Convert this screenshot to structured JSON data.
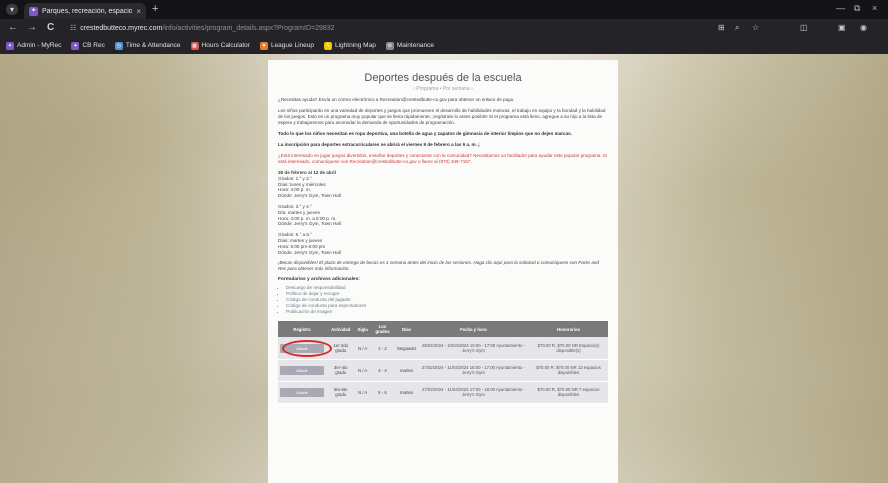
{
  "browser": {
    "tab": {
      "title": "Parques, recreación, espacios a",
      "close": "×"
    },
    "new_tab": "+",
    "window_controls": [
      "—",
      "⧉",
      "×"
    ],
    "nav": {
      "back": "←",
      "forward": "→",
      "reload": "C"
    },
    "url": {
      "host": "crestedbutteco.myrec.com",
      "path": "/info/activities/program_details.aspx?ProgramID=29832"
    },
    "bookmarks": [
      {
        "label": "Admin - MyRec",
        "color": "#7b5cc6"
      },
      {
        "label": "CB Rec",
        "color": "#7b5cc6"
      },
      {
        "label": "Time & Attendance",
        "color": "#5a8fd6"
      },
      {
        "label": "Hours Calculator",
        "color": "#d9534f"
      },
      {
        "label": "League Lineup",
        "color": "#e67e22"
      },
      {
        "label": "Lightning Map",
        "color": "#f1c40f"
      },
      {
        "label": "Maintenance",
        "color": "#888888"
      }
    ]
  },
  "program": {
    "title": "Deportes después de la escuela",
    "breadcrumb": "‹ Programa • Por semana ›",
    "p1": "¿Necesitas ayuda? Envía un correo electrónico a Recreation@crestedbutte-co.gov para obtener un enlace de pago.",
    "p2": "Los niños participarán en una variedad de deportes y juegos que promueven el desarrollo de habilidades motoras, el trabajo en equipo y la bondad y la habilidad de los juegos. Esto es un programa muy popular que se llena rápidamente, ¡regístrate lo antes posible! Si el programa está lleno, agregue a su hijo a la lista de espera y trabajaremos para acomodar la demanda de oportunidades de programación.",
    "p3": "Todo lo que los niños necesitan es ropa deportiva, una botella de agua y zapatos de gimnasia de interior limpios que no dejen marcas.",
    "p4": "La inscripción para deportes extracurriculares se abrirá el viernes 9 de febrero a las 9 a. m. ¡",
    "p5": "¿Está interesado en jugar juegos divertidos, enseñar deportes y conectarse con la comunidad? Necesitamos un facilitador para ayudar este popular programa. Si está interesado, comuníquese con Recreation@crestedbutte-co.gov o llame al (970) 349-7167.",
    "s1": [
      "28 de febrero al 12 de abril",
      "Grados: 1.° y 2.°",
      "Días: lunes y miércoles",
      "Hora: 4:00 p. m.",
      "Dónde: Jerry's Gym, Town Hall"
    ],
    "s2": [
      "Grados: 3.° y 4.°",
      "Día: martes y jueves",
      "Hora: 4:00 p. m. a 5:00 p. m.",
      "Dónde: Jerry's Gym, Town Hall"
    ],
    "s3": [
      "Grados: 5.° a 6.°",
      "Días: martes y jueves",
      "Hora: 5:00 pm-6:00 pm",
      "Dónde: Jerry's Gym, Town Hall"
    ],
    "note": "¡Becas disponibles! El plazo de entrega de becas es 1 semana antes del inicio de las sesiones. Haga clic aquí para la solicitud o comuníquese con Parks and Rec para obtener más información.",
    "files_heading": "Formularios y archivos adicionales:",
    "files": [
      "Descargo de responsabilidad",
      "Política de dejar y recoger",
      "Código de conducta del jugador",
      "Código de conducta para espectadores",
      "Publicación de imagen"
    ],
    "table": {
      "headers": [
        "Registro",
        "Actividad",
        "Sigla",
        "Los grados",
        "Días",
        "Fecha y hora",
        "Honorarios"
      ],
      "rows": [
        {
          "btn": "Añadir",
          "activity": "1er-2do grado",
          "age": "N / A",
          "grades": "1 - 2",
          "days": "Megawatt",
          "dates": "28/02/2024 - 10/04/2024 16:00 - 17:00 Ayuntamiento - Jerry's Gym",
          "fee": "$70.00 R, $70.00 NR Espacio(s) disponible(s)"
        },
        {
          "btn": "Añadir",
          "activity": "3er-4to grado",
          "age": "N / A",
          "grades": "3 - 4",
          "days": "martes",
          "dates": "27/02/2024 - 11/04/2024 16:00 - 17:00 Ayuntamiento - Jerry's Gym",
          "fee": "$70.00 R, $70.00 NR 13 espacios disponibles"
        },
        {
          "btn": "Añadir",
          "activity": "5to-6to grado",
          "age": "N / A",
          "grades": "5 - 6",
          "days": "martes",
          "dates": "27/02/2024 - 11/04/2024 17:00 - 18:00 Ayuntamiento - Jerry's Gym",
          "fee": "$70.00 R, $70.00 NR 7 espacios disponibles"
        }
      ]
    }
  }
}
